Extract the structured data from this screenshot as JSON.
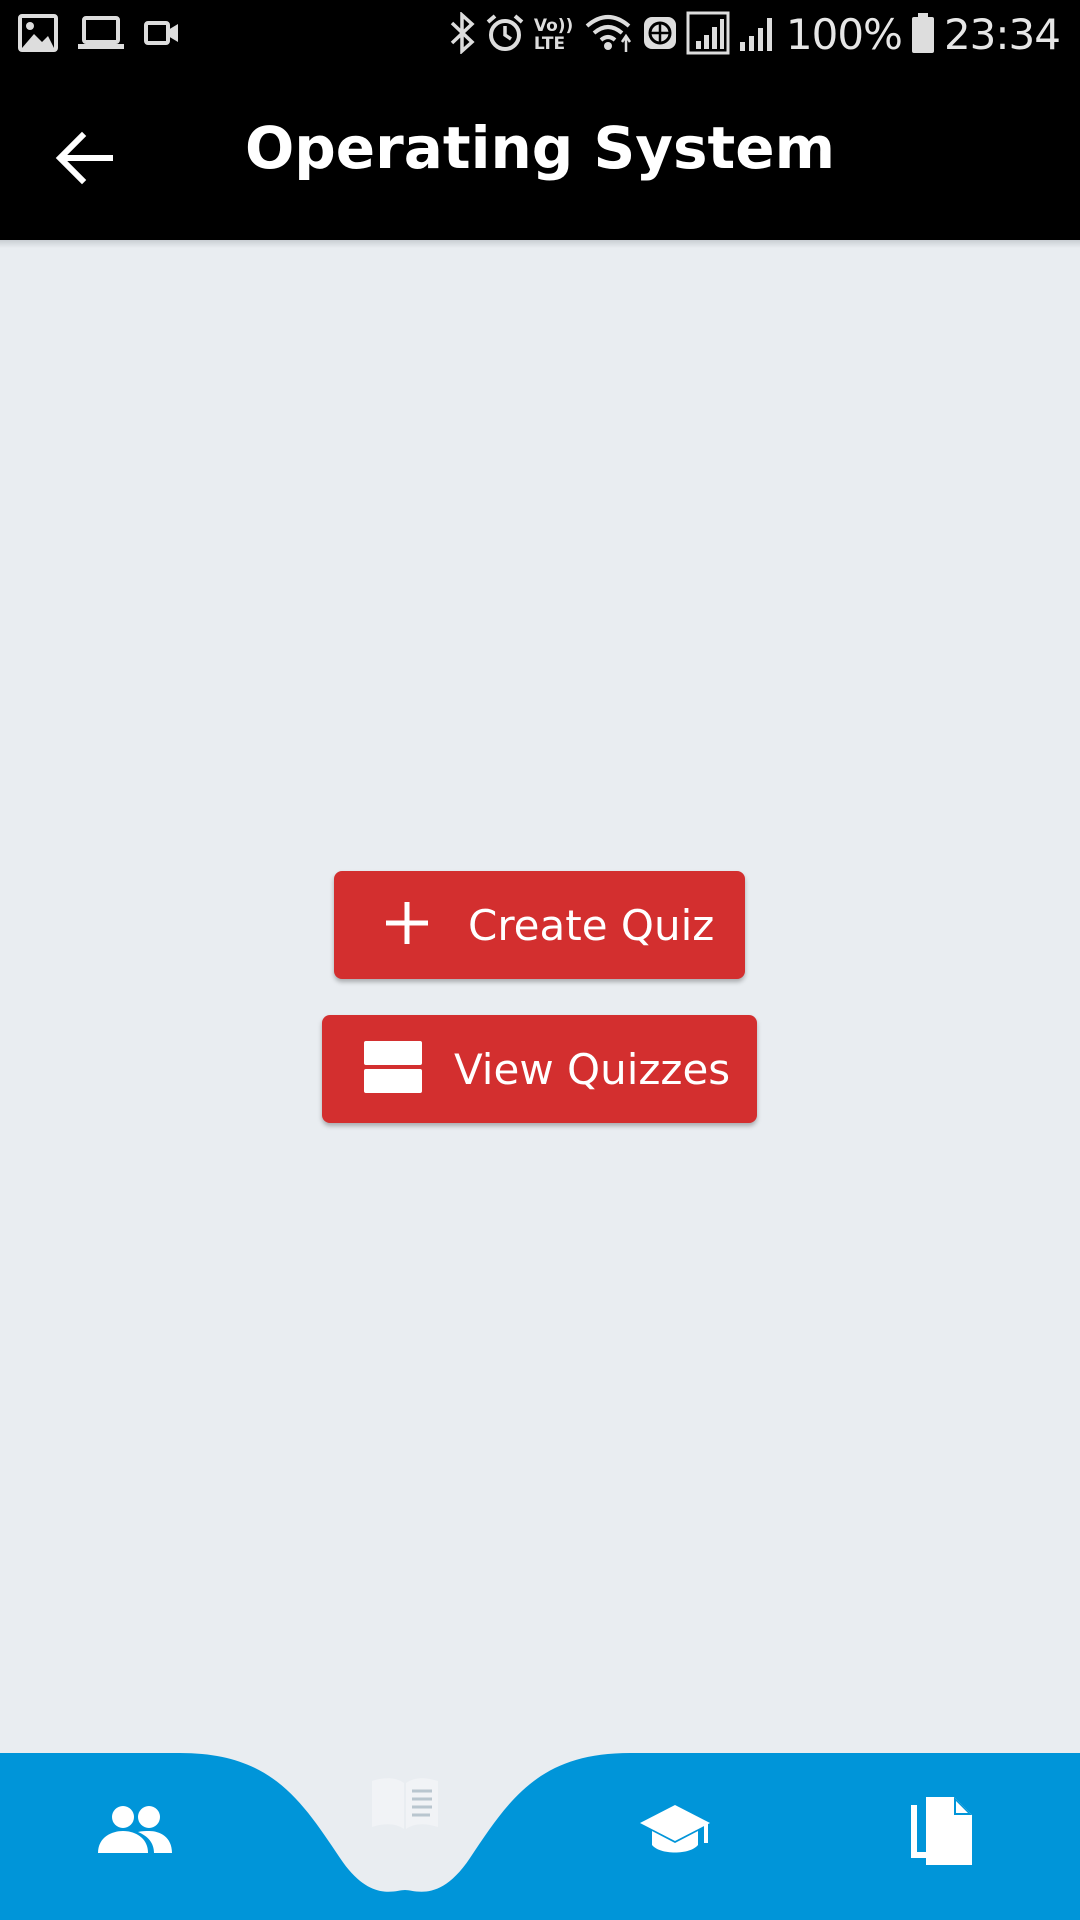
{
  "status_bar": {
    "left_icons": [
      "image-icon",
      "laptop-icon",
      "videocam-icon"
    ],
    "right_icons": [
      "bluetooth-icon",
      "alarm-icon",
      "volte-icon",
      "wifi-icon",
      "vpn-icon",
      "signal-icon",
      "signal-icon"
    ],
    "volte_label_top": "Vo))",
    "volte_label_bottom": "LTE",
    "battery": "100%",
    "time": "23:34"
  },
  "app_bar": {
    "title": "Operating System",
    "back_icon": "arrow-back-icon",
    "background": "#000000"
  },
  "actions": {
    "create_label": "Create Quiz",
    "create_icon": "plus-icon",
    "view_label": "View Quizzes",
    "view_icon": "view-list-icon",
    "button_color": "#d32f2f"
  },
  "bottom_nav": {
    "background": "#0095d9",
    "items": [
      {
        "icon": "people-icon",
        "active": false
      },
      {
        "icon": "book-icon",
        "active": true
      },
      {
        "icon": "school-icon",
        "active": false
      },
      {
        "icon": "file-copy-icon",
        "active": false
      }
    ]
  },
  "colors": {
    "page_background": "#e9edf1",
    "accent": "#0095d9"
  }
}
